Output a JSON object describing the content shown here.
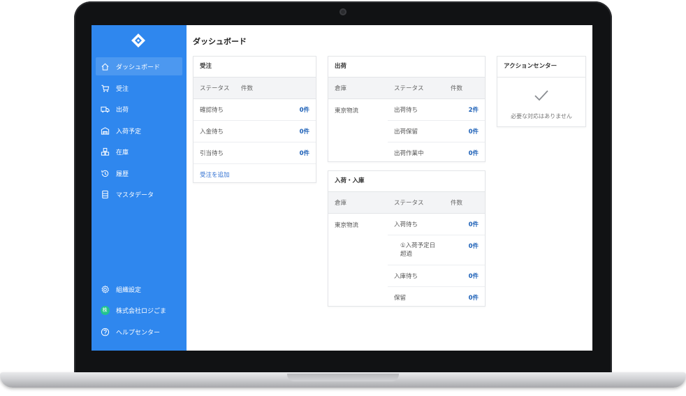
{
  "sidebar": {
    "items": [
      {
        "label": "ダッシュボード",
        "icon": "home-icon"
      },
      {
        "label": "受注",
        "icon": "cart-icon"
      },
      {
        "label": "出荷",
        "icon": "truck-icon"
      },
      {
        "label": "入荷予定",
        "icon": "warehouse-icon"
      },
      {
        "label": "在庫",
        "icon": "boxes-icon"
      },
      {
        "label": "履歴",
        "icon": "history-icon"
      },
      {
        "label": "マスタデータ",
        "icon": "database-icon"
      }
    ],
    "bottom": [
      {
        "label": "組織設定",
        "icon": "gear-icon"
      },
      {
        "label": "株式会社ロジごま",
        "icon": "company-avatar",
        "avatar_text": "株"
      },
      {
        "label": "ヘルプセンター",
        "icon": "help-icon"
      }
    ]
  },
  "page_title": "ダッシュボード",
  "orders": {
    "title": "受注",
    "headers": {
      "status": "ステータス",
      "count": "件数"
    },
    "rows": [
      {
        "status": "確認待ち",
        "count": "0件"
      },
      {
        "status": "入金待ち",
        "count": "0件"
      },
      {
        "status": "引当待ち",
        "count": "0件"
      }
    ],
    "add_link": "受注を追加"
  },
  "shipping": {
    "title": "出荷",
    "headers": {
      "warehouse": "倉庫",
      "status": "ステータス",
      "count": "件数"
    },
    "warehouse": "東京物流",
    "rows": [
      {
        "status": "出荷待ち",
        "count": "2件"
      },
      {
        "status": "出荷保留",
        "count": "0件"
      },
      {
        "status": "出荷作業中",
        "count": "0件"
      }
    ]
  },
  "receiving": {
    "title": "入荷・入庫",
    "headers": {
      "warehouse": "倉庫",
      "status": "ステータス",
      "count": "件数"
    },
    "warehouse": "東京物流",
    "rows": [
      {
        "status": "入荷待ち",
        "count": "0件"
      },
      {
        "status_line1": "①入荷予定日",
        "status_line2": "超過",
        "count": "0件"
      },
      {
        "status": "入庫待ち",
        "count": "0件"
      },
      {
        "status": "保留",
        "count": "0件"
      }
    ]
  },
  "actions": {
    "title": "アクションセンター",
    "empty_text": "必要な対応はありません"
  },
  "colors": {
    "sidebar": "#2f87ee",
    "count": "#1f62b8",
    "link": "#2f6fd1"
  }
}
